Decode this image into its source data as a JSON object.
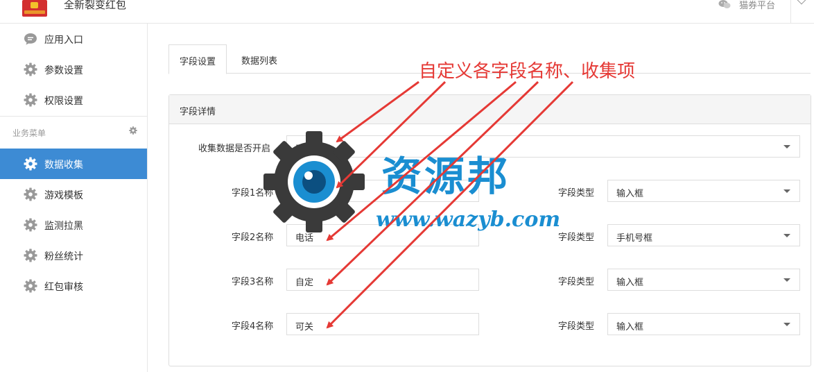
{
  "header": {
    "app_title": "全新裂变红包",
    "logo_icon": "red-envelope-logo-icon",
    "platform_label": "猫券平台",
    "platform_icon": "wechat-icon"
  },
  "sidebar": {
    "items": [
      {
        "label": "应用入口",
        "icon": "chat-bubble-icon"
      },
      {
        "label": "参数设置",
        "icon": "gear-icon"
      },
      {
        "label": "权限设置",
        "icon": "gear-icon"
      }
    ],
    "section_title": "业务菜单",
    "section_icon": "gear-icon",
    "business_items": [
      {
        "label": "数据收集",
        "icon": "gear-icon",
        "active": true
      },
      {
        "label": "游戏模板",
        "icon": "gear-icon"
      },
      {
        "label": "监测拉黑",
        "icon": "gear-icon"
      },
      {
        "label": "粉丝统计",
        "icon": "gear-icon"
      },
      {
        "label": "红包审核",
        "icon": "gear-icon"
      }
    ]
  },
  "tabs": [
    {
      "label": "字段设置",
      "active": true
    },
    {
      "label": "数据列表",
      "active": false
    }
  ],
  "panel": {
    "title": "字段详情",
    "collect": {
      "label": "收集数据是否开启",
      "value": "开启"
    },
    "fields": [
      {
        "name_label": "字段1名称",
        "name_value": "姓名",
        "type_label": "字段类型",
        "type_value": "输入框"
      },
      {
        "name_label": "字段2名称",
        "name_value": "电话",
        "type_label": "字段类型",
        "type_value": "手机号框"
      },
      {
        "name_label": "字段3名称",
        "name_value": "自定",
        "type_label": "字段类型",
        "type_value": "输入框"
      },
      {
        "name_label": "字段4名称",
        "name_value": "可关",
        "type_label": "字段类型",
        "type_value": "输入框"
      }
    ]
  },
  "annotation": {
    "text": "自定义各字段名称、收集项",
    "color": "#e53935"
  },
  "watermark": {
    "cn_text": "资源邦",
    "url_text": "www.wazyb.com",
    "color": "#1a8ed1",
    "icon": "gear-eye-logo-icon"
  },
  "colors": {
    "active_nav": "#3d8bd4",
    "border": "#dddddd"
  }
}
